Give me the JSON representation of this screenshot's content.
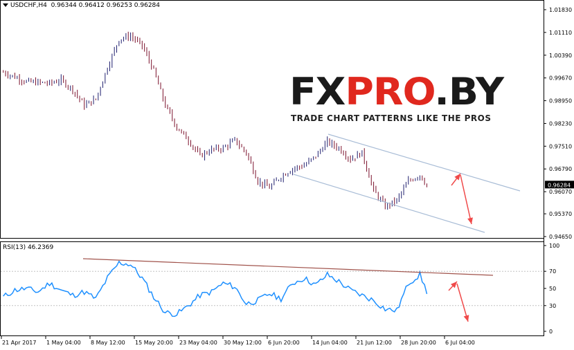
{
  "header": {
    "symbol": "USDCHF,H4",
    "quote": "0.96344 0.96412 0.96253 0.96284"
  },
  "rsi": {
    "title": "RSI(13) 46.2369",
    "levels": [
      "100",
      "70",
      "50",
      "30",
      "0"
    ]
  },
  "logo": {
    "prefix": "FX",
    "highlight": "PRO",
    "suffix": ".BY",
    "tagline": "TRADE CHART PATTERNS LIKE THE PROS"
  },
  "colors": {
    "bull_candle": "#1e1e6e",
    "bear_candle": "#7a0f2a",
    "rsi_line": "#1e90ff",
    "channel": "#a8bcd6",
    "rsi_trend": "#a0524a",
    "arrow": "#f04a4a",
    "price_tag_bg": "#000000"
  },
  "chart_data": [
    {
      "type": "candlestick",
      "title": "USDCHF,H4",
      "current_price": "0.96284",
      "ylim": [
        0.9465,
        1.0183
      ],
      "y_ticks": [
        "1.01830",
        "1.01110",
        "1.00390",
        "0.99670",
        "0.98950",
        "0.98230",
        "0.97510",
        "0.96790",
        "0.96070",
        "0.95370",
        "0.94650"
      ],
      "x_ticks": [
        "21 Apr 2017",
        "1 May 04:00",
        "8 May 12:00",
        "15 May 20:00",
        "23 May 04:00",
        "30 May 12:00",
        "6 Jun 20:00",
        "14 Jun 04:00",
        "21 Jun 12:00",
        "28 Jun 20:00",
        "6 Jul 04:00"
      ],
      "approx_close_path": [
        [
          0,
          0.9985
        ],
        [
          10,
          0.9955
        ],
        [
          20,
          0.995
        ],
        [
          25,
          0.996
        ],
        [
          30,
          0.993
        ],
        [
          35,
          0.988
        ],
        [
          40,
          0.99
        ],
        [
          45,
          1.0
        ],
        [
          50,
          1.009
        ],
        [
          55,
          1.01
        ],
        [
          60,
          1.007
        ],
        [
          65,
          0.999
        ],
        [
          70,
          0.988
        ],
        [
          75,
          0.981
        ],
        [
          80,
          0.977
        ],
        [
          85,
          0.972
        ],
        [
          90,
          0.974
        ],
        [
          95,
          0.9745
        ],
        [
          100,
          0.977
        ],
        [
          105,
          0.973
        ],
        [
          110,
          0.964
        ],
        [
          115,
          0.962
        ],
        [
          120,
          0.9655
        ],
        [
          125,
          0.968
        ],
        [
          130,
          0.969
        ],
        [
          135,
          0.972
        ],
        [
          140,
          0.9765
        ],
        [
          145,
          0.9745
        ],
        [
          150,
          0.971
        ],
        [
          155,
          0.973
        ],
        [
          160,
          0.961
        ],
        [
          165,
          0.956
        ],
        [
          170,
          0.958
        ],
        [
          175,
          0.964
        ],
        [
          180,
          0.966
        ],
        [
          183,
          0.9628
        ]
      ],
      "annotations": [
        "descending channel",
        "projected decline arrow"
      ]
    },
    {
      "type": "line",
      "title": "RSI(13) 46.2369",
      "ylim": [
        0,
        100
      ],
      "y_ticks": [
        "100",
        "70",
        "50",
        "30",
        "0"
      ],
      "series": [
        {
          "name": "RSI(13)",
          "x": [
            0,
            5,
            10,
            15,
            20,
            25,
            30,
            35,
            40,
            45,
            50,
            55,
            60,
            65,
            70,
            75,
            80,
            85,
            90,
            95,
            100,
            105,
            110,
            115,
            120,
            125,
            130,
            135,
            140,
            145,
            150,
            155,
            160,
            165,
            170,
            175,
            180,
            183
          ],
          "values": [
            40,
            48,
            50,
            46,
            56,
            48,
            42,
            46,
            38,
            62,
            80,
            78,
            62,
            40,
            22,
            20,
            30,
            42,
            46,
            56,
            52,
            32,
            36,
            44,
            38,
            56,
            62,
            54,
            66,
            58,
            48,
            42,
            36,
            26,
            24,
            56,
            66,
            46.2
          ]
        }
      ],
      "annotations": [
        "descending trendline",
        "projected decline arrow"
      ]
    }
  ]
}
